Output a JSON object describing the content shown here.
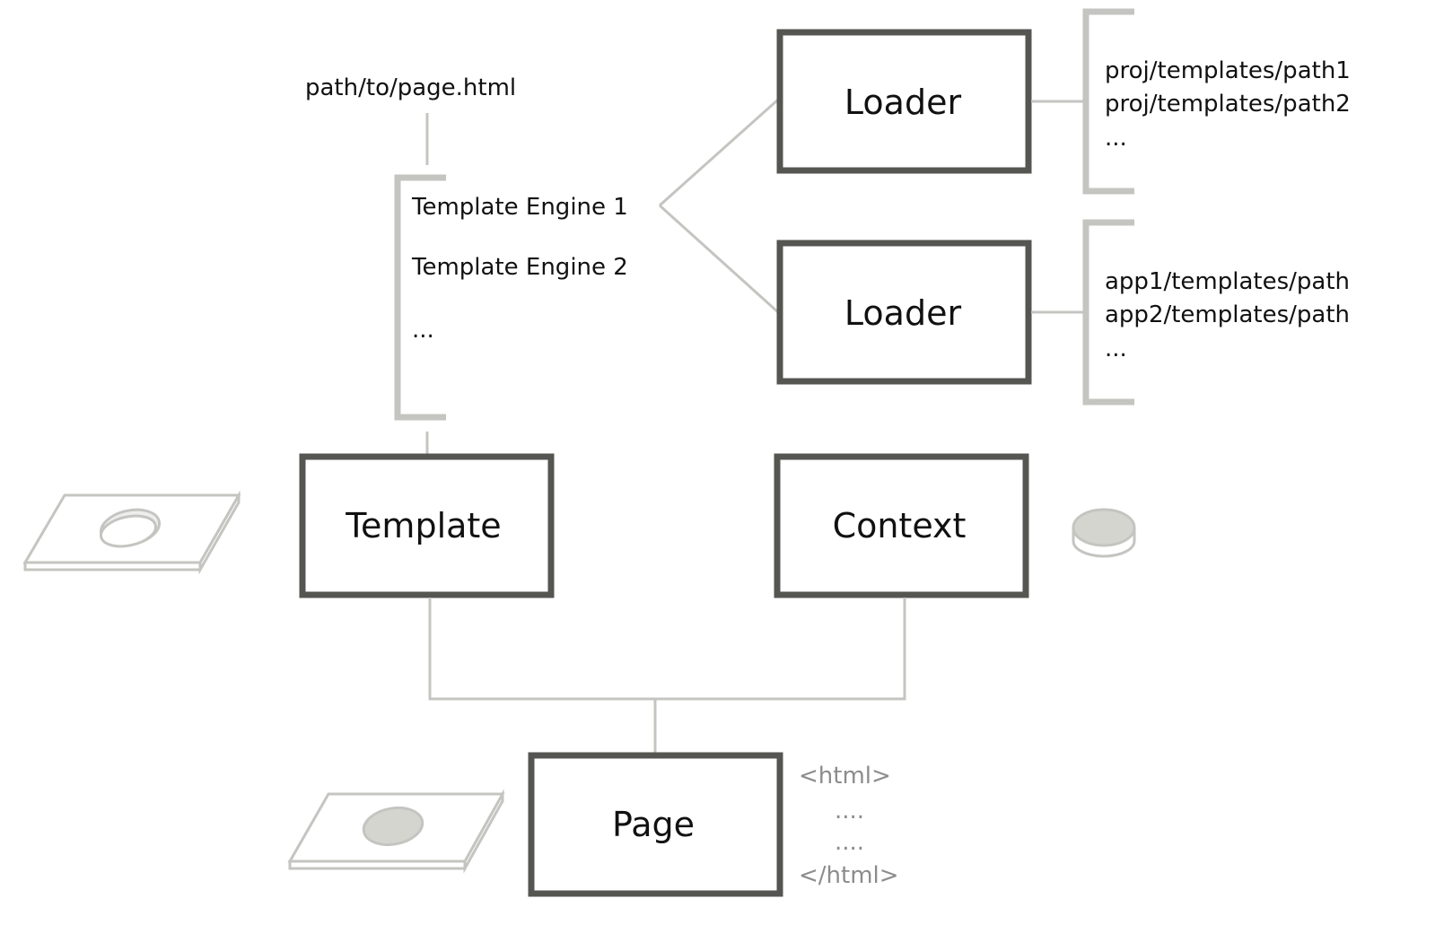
{
  "diagram": {
    "path_label": "path/to/page.html",
    "engines": {
      "items": [
        "Template Engine 1",
        "Template Engine 2",
        "..."
      ]
    },
    "loaders": [
      {
        "label": "Loader",
        "paths": [
          "proj/templates/path1",
          "proj/templates/path2",
          "..."
        ]
      },
      {
        "label": "Loader",
        "paths": [
          "app1/templates/path",
          "app2/templates/path",
          "..."
        ]
      }
    ],
    "template": {
      "label": "Template"
    },
    "context": {
      "label": "Context"
    },
    "page": {
      "label": "Page",
      "html_snippet": [
        "<html>",
        "....",
        "....",
        "</html>"
      ]
    },
    "colors": {
      "box_border": "#555652",
      "connector": "#c4c5c1",
      "icon_fill": "#d4d5cf",
      "text": "#111111",
      "muted_text": "#8c8c8c"
    }
  }
}
